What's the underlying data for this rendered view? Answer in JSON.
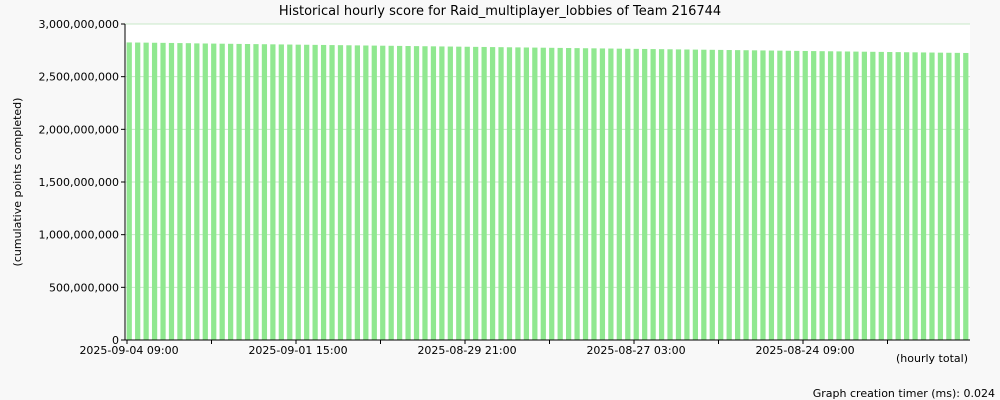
{
  "chart_data": {
    "type": "bar",
    "title": "Historical hourly score for Raid_multiplayer_lobbies of Team 216744",
    "ylabel": "(cumulative points completed)",
    "xlabel": "(hourly total)",
    "ylim": [
      0,
      3000000000
    ],
    "yticks": [
      {
        "value": 0,
        "label": "0"
      },
      {
        "value": 500000000,
        "label": "500,000,000"
      },
      {
        "value": 1000000000,
        "label": "1,000,000,000"
      },
      {
        "value": 1500000000,
        "label": "1,500,000,000"
      },
      {
        "value": 2000000000,
        "label": "2,000,000,000"
      },
      {
        "value": 2500000000,
        "label": "2,500,000,000"
      },
      {
        "value": 3000000000,
        "label": "3,000,000,000"
      }
    ],
    "xticks": [
      {
        "index": 0,
        "label": "2025-09-04 09:00"
      },
      {
        "index": 10,
        "label": ""
      },
      {
        "index": 20,
        "label": "2025-09-01 15:00"
      },
      {
        "index": 30,
        "label": ""
      },
      {
        "index": 40,
        "label": "2025-08-29 21:00"
      },
      {
        "index": 50,
        "label": ""
      },
      {
        "index": 60,
        "label": "2025-08-27 03:00"
      },
      {
        "index": 70,
        "label": ""
      },
      {
        "index": 80,
        "label": "2025-08-24 09:00"
      },
      {
        "index": 90,
        "label": ""
      }
    ],
    "values": [
      2825000000,
      2824000000,
      2823000000,
      2822000000,
      2821000000,
      2820000000,
      2819000000,
      2818000000,
      2816000000,
      2815000000,
      2814000000,
      2813000000,
      2812000000,
      2811000000,
      2810000000,
      2809000000,
      2808000000,
      2807000000,
      2806000000,
      2805000000,
      2804000000,
      2803000000,
      2802000000,
      2801000000,
      2800000000,
      2799000000,
      2798000000,
      2797000000,
      2796000000,
      2795000000,
      2794000000,
      2793000000,
      2792000000,
      2791000000,
      2790000000,
      2789000000,
      2788000000,
      2787000000,
      2786000000,
      2785000000,
      2784000000,
      2783000000,
      2782000000,
      2781000000,
      2780000000,
      2779000000,
      2778000000,
      2777000000,
      2776000000,
      2775000000,
      2774000000,
      2773000000,
      2772000000,
      2771000000,
      2770000000,
      2769000000,
      2768000000,
      2767000000,
      2766000000,
      2765000000,
      2764000000,
      2763000000,
      2762000000,
      2761000000,
      2760000000,
      2759000000,
      2758000000,
      2757000000,
      2756000000,
      2755000000,
      2754000000,
      2753000000,
      2752000000,
      2751000000,
      2750000000,
      2749000000,
      2748000000,
      2747000000,
      2746000000,
      2745000000,
      2744000000,
      2743000000,
      2742000000,
      2741000000,
      2740000000,
      2739000000,
      2738000000,
      2737000000,
      2736000000,
      2735000000,
      2734000000,
      2733000000,
      2732000000,
      2731000000,
      2730000000,
      2729000000,
      2728000000,
      2727000000,
      2726000000,
      2725000000
    ],
    "bar_color": "#90e890",
    "grid": true,
    "legend": "none"
  },
  "footer": {
    "timer_text": "Graph creation timer (ms): 0.024"
  }
}
